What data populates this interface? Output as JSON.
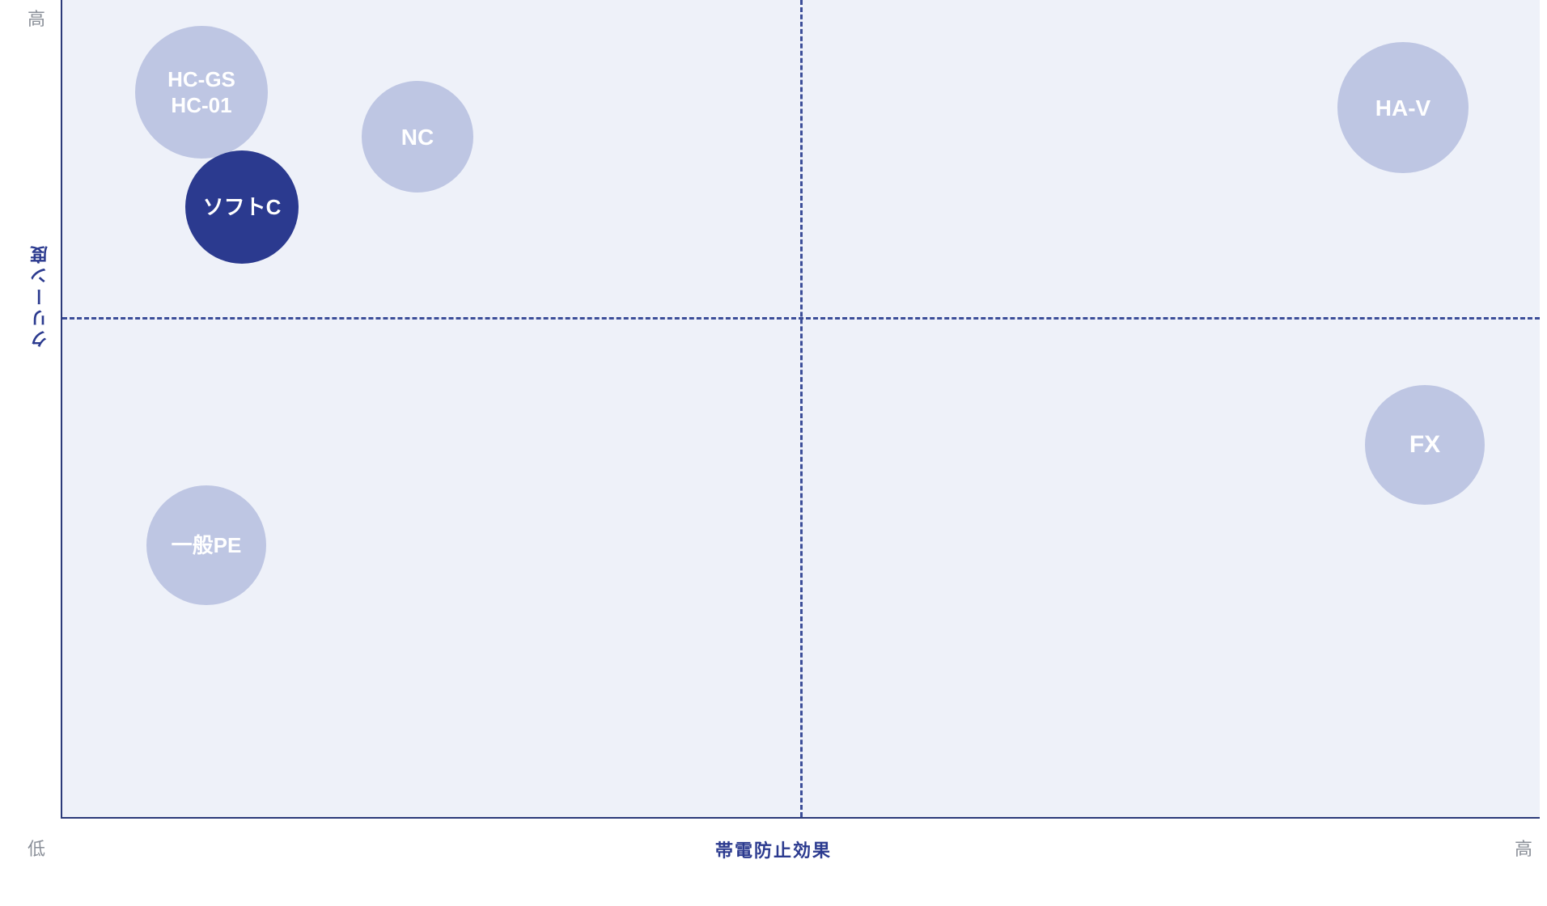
{
  "chart_data": {
    "type": "scatter",
    "title": "",
    "xlabel": "帯電防止効果",
    "ylabel": "クリーン度",
    "xlim": [
      0,
      100
    ],
    "ylim": [
      0,
      100
    ],
    "x_ticks": {
      "low": "低",
      "high": "高"
    },
    "y_ticks": {
      "low": "低",
      "high": "高"
    },
    "series": [
      {
        "name": "HC-GS / HC-01",
        "labels": [
          "HC-GS",
          "HC-01"
        ],
        "x": 10,
        "y": 90,
        "r": 80,
        "highlight": false
      },
      {
        "name": "ソフトC",
        "labels": [
          "ソフトC"
        ],
        "x": 15,
        "y": 74,
        "r": 68,
        "highlight": true
      },
      {
        "name": "NC",
        "labels": [
          "NC"
        ],
        "x": 26,
        "y": 83,
        "r": 68,
        "highlight": false
      },
      {
        "name": "HA-V",
        "labels": [
          "HA-V"
        ],
        "x": 91,
        "y": 88,
        "r": 80,
        "highlight": false
      },
      {
        "name": "一般PE",
        "labels": [
          "一般PE"
        ],
        "x": 12,
        "y": 32,
        "r": 72,
        "highlight": false
      },
      {
        "name": "FX",
        "labels": [
          "FX"
        ],
        "x": 93,
        "y": 45,
        "r": 72,
        "highlight": false
      }
    ]
  }
}
